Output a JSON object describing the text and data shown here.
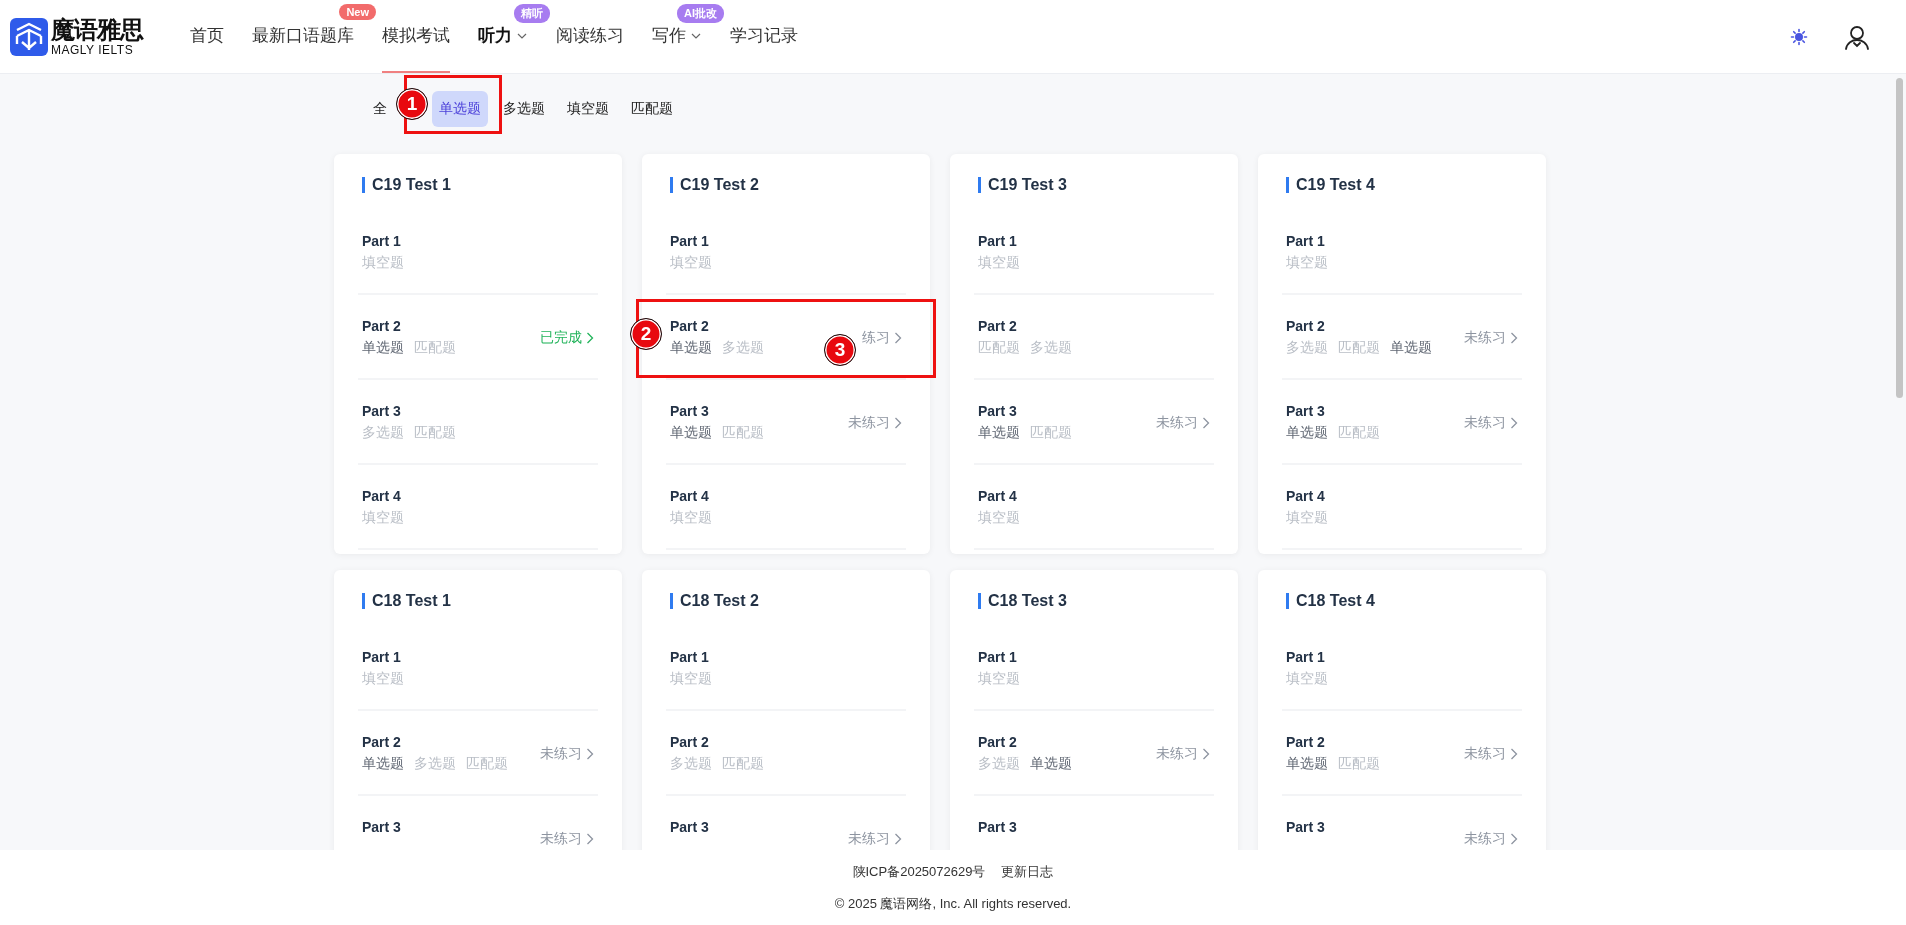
{
  "header": {
    "logo": {
      "title": "魔语雅思",
      "subtitle": "MAGLY IELTS"
    },
    "nav": [
      {
        "label": "首页",
        "selected": false,
        "underlined": false
      },
      {
        "label": "最新口语题库",
        "selected": false,
        "underlined": false,
        "badge": {
          "text": "New",
          "color": "#f26b6b"
        }
      },
      {
        "label": "模拟考试",
        "selected": false,
        "underlined": true
      },
      {
        "label": "听力",
        "selected": true,
        "underlined": false,
        "dropdown": true,
        "badge": {
          "text": "精听",
          "color": "#a77cf0"
        }
      },
      {
        "label": "阅读练习",
        "selected": false,
        "underlined": false
      },
      {
        "label": "写作",
        "selected": false,
        "underlined": false,
        "dropdown": true,
        "badge": {
          "text": "AI批改",
          "color": "#a77cf0"
        }
      },
      {
        "label": "学习记录",
        "selected": false,
        "underlined": false
      }
    ]
  },
  "filters": [
    {
      "label": "全",
      "selected": false
    },
    {
      "label": "单选题",
      "selected": true
    },
    {
      "label": "多选题",
      "selected": false
    },
    {
      "label": "填空题",
      "selected": false
    },
    {
      "label": "匹配题",
      "selected": false
    }
  ],
  "tests": [
    {
      "title": "C19 Test 1",
      "parts": [
        {
          "title": "Part 1",
          "tags": [
            {
              "text": "填空题",
              "active": false
            }
          ]
        },
        {
          "title": "Part 2",
          "tags": [
            {
              "text": "单选题",
              "active": true
            },
            {
              "text": "匹配题",
              "active": false
            }
          ],
          "status": {
            "kind": "done",
            "text": "已完成"
          }
        },
        {
          "title": "Part 3",
          "tags": [
            {
              "text": "多选题",
              "active": false
            },
            {
              "text": "匹配题",
              "active": false
            }
          ]
        },
        {
          "title": "Part 4",
          "tags": [
            {
              "text": "填空题",
              "active": false
            }
          ]
        }
      ]
    },
    {
      "title": "C19 Test 2",
      "parts": [
        {
          "title": "Part 1",
          "tags": [
            {
              "text": "填空题",
              "active": false
            }
          ]
        },
        {
          "title": "Part 2",
          "tags": [
            {
              "text": "单选题",
              "active": true
            },
            {
              "text": "多选题",
              "active": false
            }
          ],
          "status": {
            "kind": "todo",
            "text": "练习"
          }
        },
        {
          "title": "Part 3",
          "tags": [
            {
              "text": "单选题",
              "active": true
            },
            {
              "text": "匹配题",
              "active": false
            }
          ],
          "status": {
            "kind": "todo",
            "text": "未练习"
          }
        },
        {
          "title": "Part 4",
          "tags": [
            {
              "text": "填空题",
              "active": false
            }
          ]
        }
      ]
    },
    {
      "title": "C19 Test 3",
      "parts": [
        {
          "title": "Part 1",
          "tags": [
            {
              "text": "填空题",
              "active": false
            }
          ]
        },
        {
          "title": "Part 2",
          "tags": [
            {
              "text": "匹配题",
              "active": false
            },
            {
              "text": "多选题",
              "active": false
            }
          ]
        },
        {
          "title": "Part 3",
          "tags": [
            {
              "text": "单选题",
              "active": true
            },
            {
              "text": "匹配题",
              "active": false
            }
          ],
          "status": {
            "kind": "todo",
            "text": "未练习"
          }
        },
        {
          "title": "Part 4",
          "tags": [
            {
              "text": "填空题",
              "active": false
            }
          ]
        }
      ]
    },
    {
      "title": "C19 Test 4",
      "parts": [
        {
          "title": "Part 1",
          "tags": [
            {
              "text": "填空题",
              "active": false
            }
          ]
        },
        {
          "title": "Part 2",
          "tags": [
            {
              "text": "多选题",
              "active": false
            },
            {
              "text": "匹配题",
              "active": false
            },
            {
              "text": "单选题",
              "active": true
            }
          ],
          "status": {
            "kind": "todo",
            "text": "未练习"
          }
        },
        {
          "title": "Part 3",
          "tags": [
            {
              "text": "单选题",
              "active": true
            },
            {
              "text": "匹配题",
              "active": false
            }
          ],
          "status": {
            "kind": "todo",
            "text": "未练习"
          }
        },
        {
          "title": "Part 4",
          "tags": [
            {
              "text": "填空题",
              "active": false
            }
          ]
        }
      ]
    },
    {
      "title": "C18 Test 1",
      "parts": [
        {
          "title": "Part 1",
          "tags": [
            {
              "text": "填空题",
              "active": false
            }
          ]
        },
        {
          "title": "Part 2",
          "tags": [
            {
              "text": "单选题",
              "active": true
            },
            {
              "text": "多选题",
              "active": false
            },
            {
              "text": "匹配题",
              "active": false
            }
          ],
          "status": {
            "kind": "todo",
            "text": "未练习"
          }
        },
        {
          "title": "Part 3",
          "status": {
            "kind": "todo",
            "text": "未练习"
          }
        }
      ]
    },
    {
      "title": "C18 Test 2",
      "parts": [
        {
          "title": "Part 1",
          "tags": [
            {
              "text": "填空题",
              "active": false
            }
          ]
        },
        {
          "title": "Part 2",
          "tags": [
            {
              "text": "多选题",
              "active": false
            },
            {
              "text": "匹配题",
              "active": false
            }
          ]
        },
        {
          "title": "Part 3",
          "status": {
            "kind": "todo",
            "text": "未练习"
          }
        }
      ]
    },
    {
      "title": "C18 Test 3",
      "parts": [
        {
          "title": "Part 1",
          "tags": [
            {
              "text": "填空题",
              "active": false
            }
          ]
        },
        {
          "title": "Part 2",
          "tags": [
            {
              "text": "多选题",
              "active": false
            },
            {
              "text": "单选题",
              "active": true
            }
          ],
          "status": {
            "kind": "todo",
            "text": "未练习"
          }
        },
        {
          "title": "Part 3"
        }
      ]
    },
    {
      "title": "C18 Test 4",
      "parts": [
        {
          "title": "Part 1",
          "tags": [
            {
              "text": "填空题",
              "active": false
            }
          ]
        },
        {
          "title": "Part 2",
          "tags": [
            {
              "text": "单选题",
              "active": true
            },
            {
              "text": "匹配题",
              "active": false
            }
          ],
          "status": {
            "kind": "todo",
            "text": "未练习"
          }
        },
        {
          "title": "Part 3",
          "status": {
            "kind": "todo",
            "text": "未练习"
          }
        }
      ]
    }
  ],
  "footer": {
    "icp": "陕ICP备2025072629号",
    "changelog": "更新日志",
    "copyright": "© 2025 魔语网络, Inc. All rights reserved."
  },
  "annotations": [
    {
      "number": "1"
    },
    {
      "number": "2"
    },
    {
      "number": "3"
    }
  ]
}
